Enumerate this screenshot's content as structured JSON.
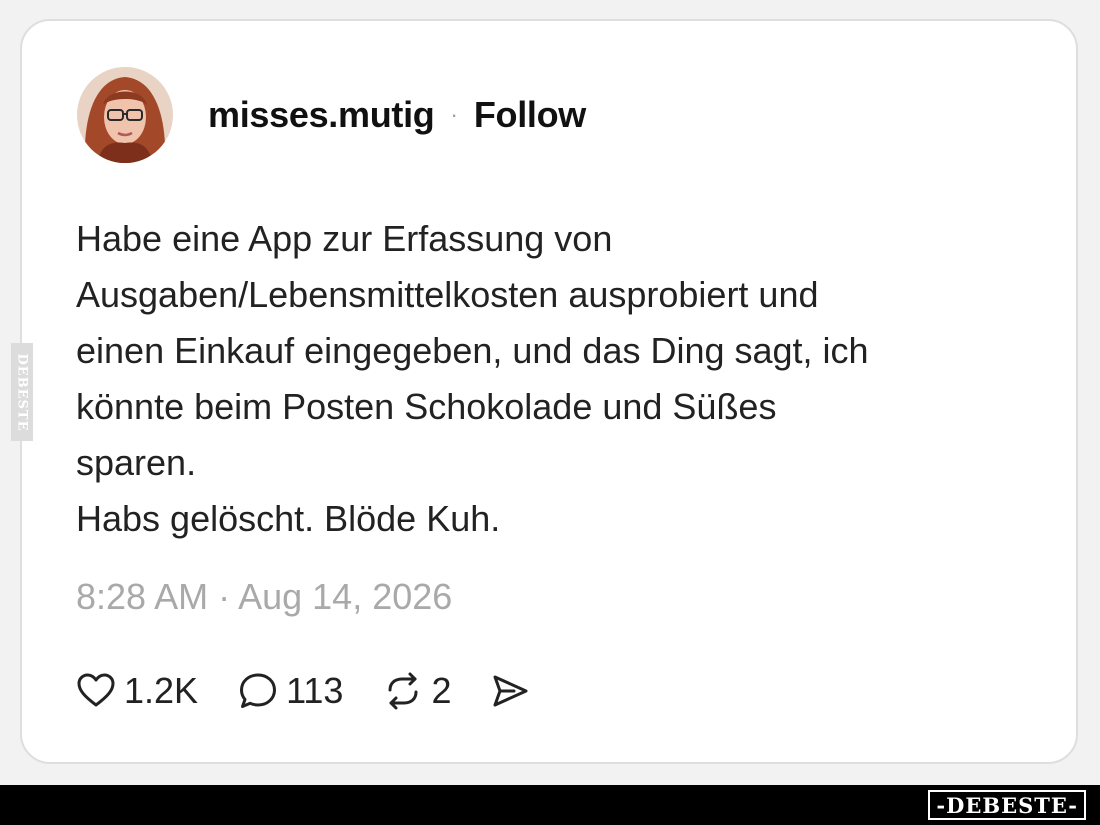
{
  "post": {
    "username": "misses.mutig",
    "separator": "·",
    "follow_label": "Follow",
    "text_lines": [
      "Habe eine App zur Erfassung von",
      "Ausgaben/Lebensmittelkosten ausprobiert und",
      "einen Einkauf eingegeben, und das Ding sagt, ich",
      "könnte beim Posten Schokolade und Süßes",
      "sparen.",
      "Habs gelöscht. Blöde Kuh."
    ],
    "timestamp": "8:28 AM · Aug 14, 2026"
  },
  "actions": {
    "likes": {
      "icon": "heart-icon",
      "count": "1.2K"
    },
    "replies": {
      "icon": "comment-icon",
      "count": "113"
    },
    "reposts": {
      "icon": "repost-icon",
      "count": "2"
    },
    "share": {
      "icon": "send-icon"
    }
  },
  "watermark": {
    "bottom": "-DEBESTE-",
    "side": "DEBESTE"
  },
  "colors": {
    "card_background": "#ffffff",
    "page_background": "#f2f2f2",
    "timestamp": "#a9a9a9",
    "bar": "#000000"
  }
}
